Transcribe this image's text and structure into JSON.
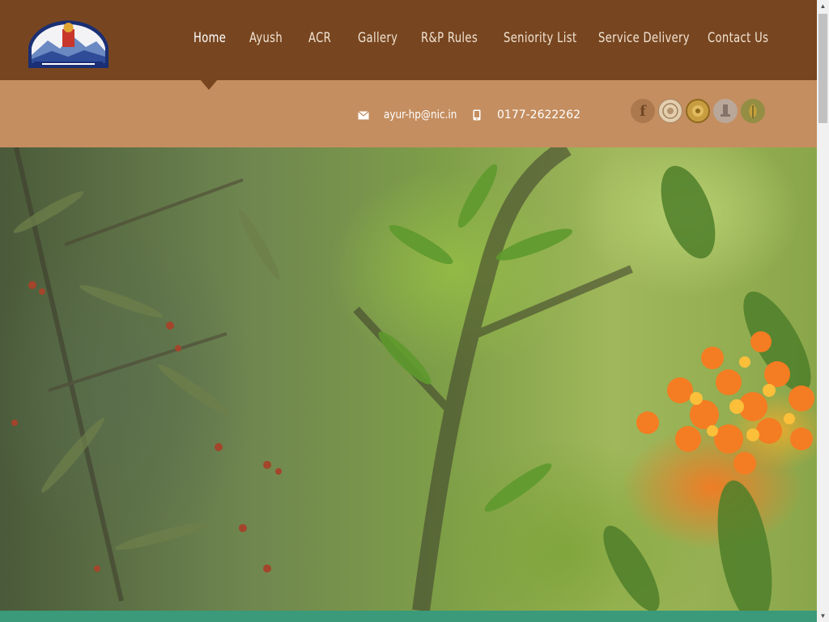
{
  "header": {
    "logo_icon": "himachal-pradesh-emblem-icon",
    "nav": [
      {
        "label": "Home",
        "active": true
      },
      {
        "label": "Ayush",
        "active": false
      },
      {
        "label": "ACR",
        "active": false
      },
      {
        "label": "Gallery",
        "active": false
      },
      {
        "label": "R&P Rules",
        "active": false
      },
      {
        "label": "Seniority List",
        "active": false
      },
      {
        "label": "Service Delivery",
        "active": false
      },
      {
        "label": "Contact Us",
        "active": false
      }
    ]
  },
  "contact": {
    "email_icon": "envelope-icon",
    "email": "ayur-hp@nic.in",
    "phone_icon": "mobile-phone-icon",
    "phone": "0177-2622262"
  },
  "socials": [
    {
      "icon": "facebook-icon",
      "label": "f"
    },
    {
      "icon": "seal-emblem-icon"
    },
    {
      "icon": "gold-emblem-icon"
    },
    {
      "icon": "ashoka-emblem-icon"
    },
    {
      "icon": "ayush-logo-icon"
    }
  ],
  "hero": {
    "image": "medicinal-plants-banner"
  },
  "colors": {
    "topbar": "#774620",
    "subbar": "#c48e60",
    "bottombar": "#3a9a7a",
    "nav_text": "#f2e3d3"
  }
}
